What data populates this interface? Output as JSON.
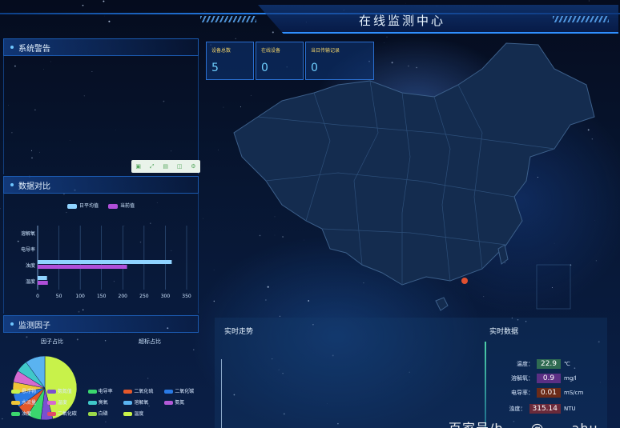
{
  "header": {
    "title": "在线监测中心"
  },
  "panels": {
    "alarm": {
      "title": "系统警告",
      "cols": [
        "",
        "",
        ""
      ]
    },
    "compare": {
      "title": "数据对比",
      "legend": [
        "日平均值",
        "当前值"
      ]
    },
    "factor": {
      "title": "监测因子",
      "pie_titles": [
        "因子占比",
        "超标占比"
      ],
      "legend": [
        "悬浮物",
        "氨氮值",
        "电导率",
        "二氧化硫",
        "二氧化碳",
        "水流量",
        "温度",
        "臭氧",
        "溶解氧",
        "氨氮",
        "浊度",
        "二氧化碳",
        "白磷",
        "温度"
      ]
    }
  },
  "cards": [
    {
      "label": "设备总数",
      "value": "5"
    },
    {
      "label": "在线设备",
      "value": "0"
    },
    {
      "label": "当日传输记录",
      "value": "0"
    }
  ],
  "bottom": {
    "trend_title": "实时走势",
    "realtime_title": "实时数据",
    "readings": [
      {
        "label": "温度：",
        "value": "22.9",
        "unit": "℃",
        "color": "#2f6b52"
      },
      {
        "label": "溶解氧：",
        "value": "0.9",
        "unit": "mg/l",
        "color": "#5b2f84"
      },
      {
        "label": "电导率：",
        "value": "0.01",
        "unit": "mS/cm",
        "color": "#6b2b18"
      },
      {
        "label": "浊度：",
        "value": "315.14",
        "unit": "NTU",
        "color": "#6a2a3a"
      }
    ]
  },
  "toolbox_icons": [
    "restore-icon",
    "fullscreen-icon",
    "data-view-icon",
    "chart-switch-icon",
    "settings-icon"
  ],
  "watermark": "百家号/b……@……ahu……88",
  "chart_data": {
    "type": "bar",
    "categories": [
      "温度",
      "浊度",
      "电导率",
      "溶解氧"
    ],
    "series": [
      {
        "name": "日平均值",
        "values": [
          22,
          315,
          0,
          0
        ],
        "color": "#8fd3ff"
      },
      {
        "name": "当前值",
        "values": [
          24,
          210,
          0,
          0
        ],
        "color": "#b04fd9"
      }
    ],
    "xlim": [
      0,
      350
    ],
    "xticks": [
      0,
      50,
      100,
      150,
      200,
      250,
      300,
      350
    ],
    "orientation": "horizontal"
  },
  "pie_data": {
    "type": "pie",
    "slices": [
      {
        "name": "悬浮物",
        "value": 46,
        "color": "#c8f24a"
      },
      {
        "name": "氨氮值",
        "value": 6,
        "color": "#7a4fd0"
      },
      {
        "name": "电导率",
        "value": 7,
        "color": "#3bd76e"
      },
      {
        "name": "二氧化硫",
        "value": 6,
        "color": "#e4582a"
      },
      {
        "name": "二氧化碳",
        "value": 7,
        "color": "#2a7ae4"
      },
      {
        "name": "水流量",
        "value": 6,
        "color": "#f0c537"
      },
      {
        "name": "温度",
        "value": 6,
        "color": "#d66ad0"
      },
      {
        "name": "臭氧",
        "value": 6,
        "color": "#40c8c9"
      },
      {
        "name": "溶解氧",
        "value": 10,
        "color": "#5ab3f0"
      }
    ]
  }
}
